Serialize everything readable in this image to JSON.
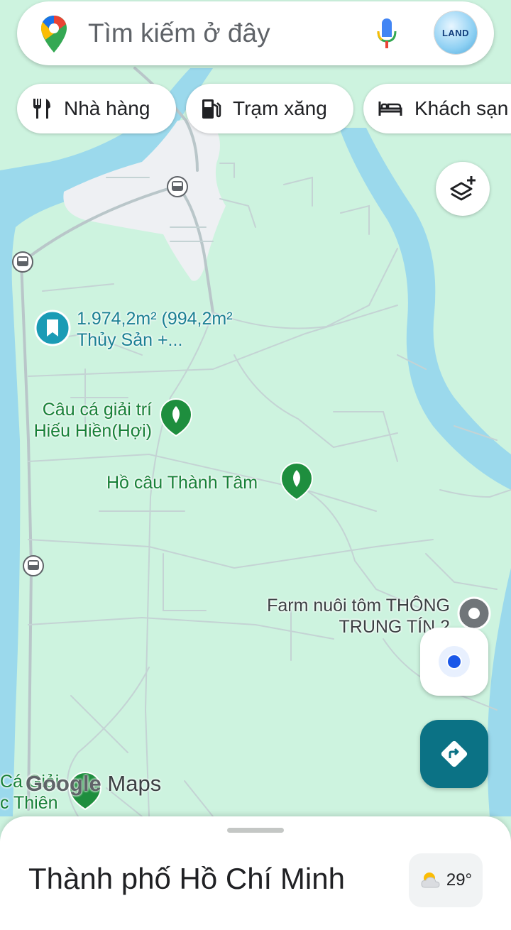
{
  "search": {
    "placeholder": "Tìm kiếm ở đây",
    "avatar_text": "LAND"
  },
  "chips": [
    {
      "label": "Nhà hàng",
      "icon": "restaurant-icon"
    },
    {
      "label": "Trạm xăng",
      "icon": "gas-station-icon"
    },
    {
      "label": "Khách sạn",
      "icon": "hotel-icon"
    }
  ],
  "map": {
    "labels": {
      "land_listing_line1": "1.974,2m² (994,2m²",
      "land_listing_line2": "Thủy Sản +...",
      "fishing1_line1": "Câu cá giải trí",
      "fishing1_line2": "Hiếu Hiền(Hợi)",
      "fishing2": "Hồ câu Thành Tâm",
      "farm_line1": "Farm nuôi tôm THÔNG",
      "farm_line2": "TRUNG TÍN 2",
      "partial1": "Cá Giải",
      "partial2": "c Thiên"
    },
    "colors": {
      "land": "#cdf3df",
      "water": "#9bd9ec",
      "urban": "#eef0f3",
      "road": "#b9c6c9",
      "poi_green": "#1e8e3e",
      "poi_teal": "#1a9bb5"
    }
  },
  "watermark": {
    "google": "Google",
    "maps": "Maps"
  },
  "sheet": {
    "place_name": "Thành phố Hồ Chí Minh",
    "temperature": "29°",
    "weather_icon": "partly-cloudy-icon"
  }
}
